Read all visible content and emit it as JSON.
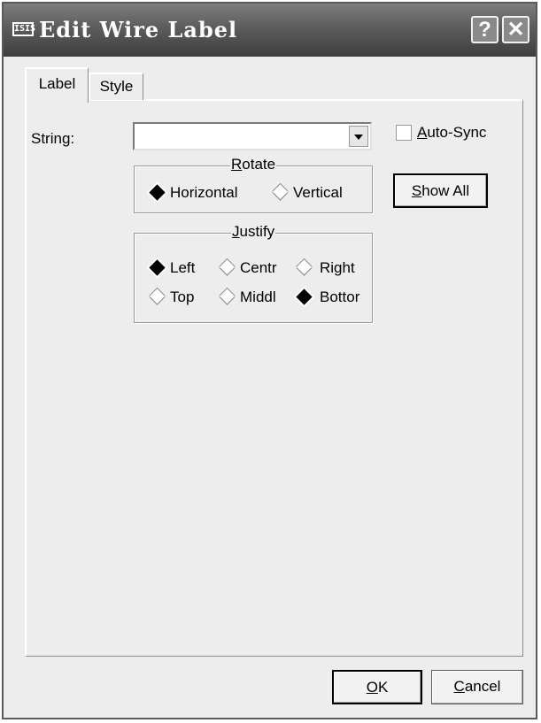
{
  "window": {
    "app_icon_text": "ISIS",
    "title": "Edit Wire Label",
    "help_glyph": "?",
    "close_glyph": "✕"
  },
  "tabs": [
    {
      "label": "Label",
      "selected": true
    },
    {
      "label": "Style",
      "selected": false
    }
  ],
  "string_field": {
    "label": "String:",
    "value": ""
  },
  "auto_sync": {
    "label_accel": "A",
    "label_rest": "uto-Sync",
    "checked": false
  },
  "show_all": {
    "label_accel": "S",
    "label_rest": "how All"
  },
  "rotate": {
    "legend_accel": "R",
    "legend_rest": "otate",
    "options": [
      {
        "label": "Horizontal",
        "checked": true
      },
      {
        "label": "Vertical",
        "checked": false
      }
    ]
  },
  "justify": {
    "legend_accel": "J",
    "legend_rest": "ustify",
    "horizontal": [
      {
        "label": "Left",
        "checked": true
      },
      {
        "label": "Centr",
        "checked": false
      },
      {
        "label": "Right",
        "checked": false
      }
    ],
    "vertical": [
      {
        "label": "Top",
        "checked": false
      },
      {
        "label": "Middl",
        "checked": false
      },
      {
        "label": "Bottor",
        "checked": true
      }
    ]
  },
  "footer": {
    "ok_accel": "O",
    "ok_rest": "K",
    "cancel_accel": "C",
    "cancel_rest": "ancel"
  }
}
